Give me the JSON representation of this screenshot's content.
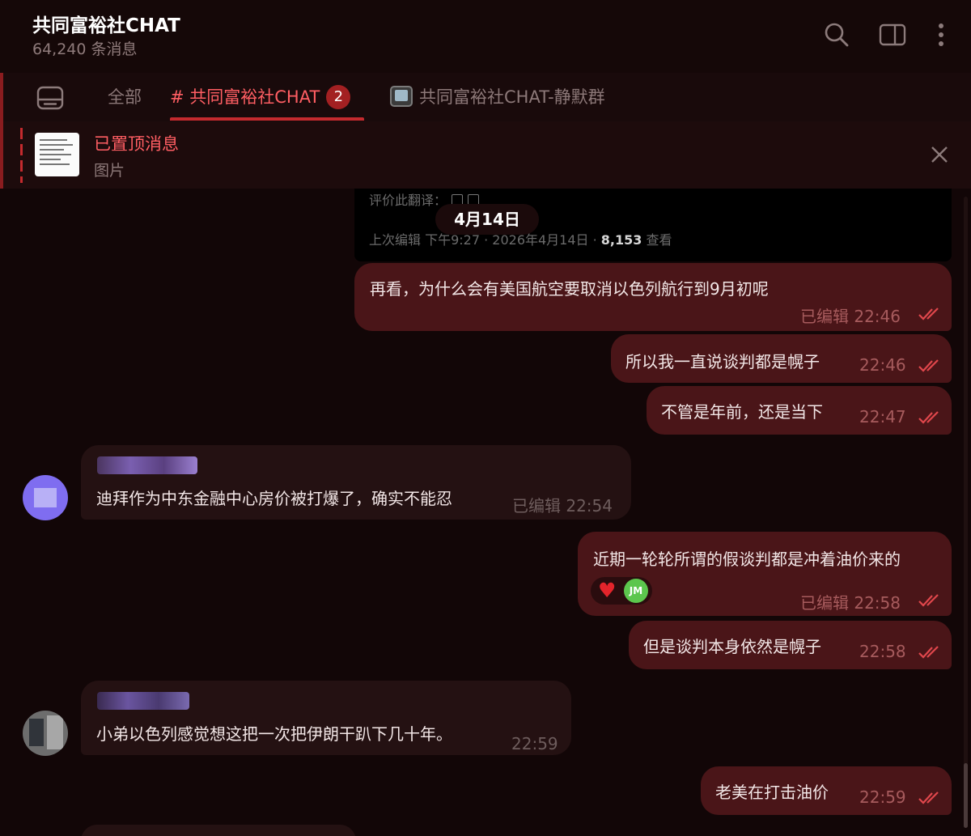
{
  "header": {
    "title": "共同富裕社CHAT",
    "subtitle": "64,240 条消息",
    "icons": [
      "search-icon",
      "sidebar-toggle-icon",
      "more-vertical-icon"
    ]
  },
  "tabs": {
    "items": [
      {
        "label": "全部"
      },
      {
        "label": "# 共同富裕社CHAT",
        "badge": "2",
        "active": true
      },
      {
        "label": "共同富裕社CHAT-静默群"
      }
    ]
  },
  "pinned": {
    "title": "已置顶消息",
    "subtitle": "图片"
  },
  "embed": {
    "rate_label": "评价此翻译：",
    "edit_prefix": "上次编辑 下午9:27 · 2026年4月14日 · ",
    "views_count": "8,153",
    "views_suffix": " 查看"
  },
  "date_separator": "4月14日",
  "messages": [
    {
      "direction": "out",
      "text": "再看，为什么会有美国航空要取消以色列航行到9月初呢",
      "meta": "已编辑 22:46",
      "read": true
    },
    {
      "direction": "out",
      "text": "所以我一直说谈判都是幌子",
      "meta": "22:46",
      "read": true
    },
    {
      "direction": "out",
      "text": "不管是年前，还是当下",
      "meta": "22:47",
      "read": true
    },
    {
      "direction": "in",
      "text": "迪拜作为中东金融中心房价被打爆了，确实不能忍",
      "meta": "已编辑 22:54"
    },
    {
      "direction": "out",
      "text": "近期一轮轮所谓的假谈判都是冲着油价来的",
      "meta": "已编辑 22:58",
      "read": true,
      "reaction": {
        "emoji": "heart",
        "avatar": "JM"
      }
    },
    {
      "direction": "out",
      "text": "但是谈判本身依然是幌子",
      "meta": "22:58",
      "read": true
    },
    {
      "direction": "in",
      "text": "小弟以色列感觉想这把一次把伊朗干趴下几十年。",
      "meta": "22:59"
    },
    {
      "direction": "out",
      "text": "老美在打击油价",
      "meta": "22:59",
      "read": true
    }
  ],
  "colors": {
    "accent": "#ff5e63",
    "outgoing_bubble": "#4a1518",
    "incoming_bubble": "#241112",
    "background": "#120607"
  }
}
